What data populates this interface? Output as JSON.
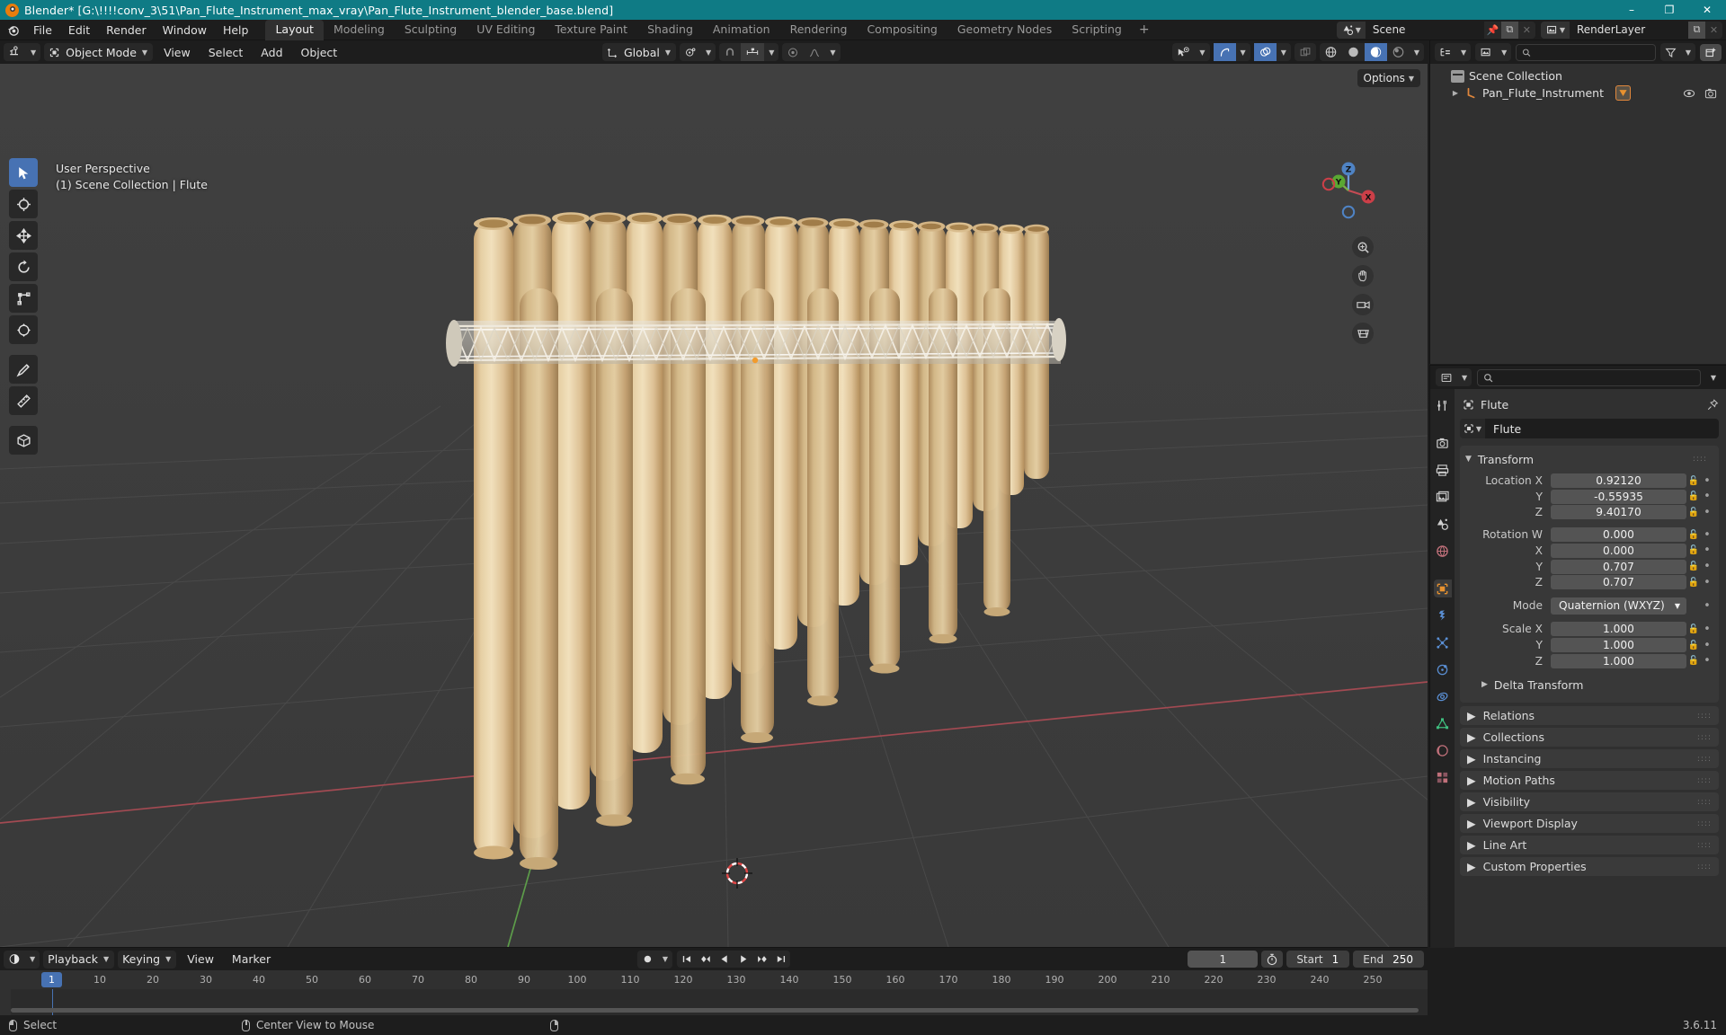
{
  "window": {
    "title": "Blender* [G:\\!!!!conv_3\\51\\Pan_Flute_Instrument_max_vray\\Pan_Flute_Instrument_blender_base.blend]",
    "minimize": "–",
    "maximize": "❐",
    "close": "✕"
  },
  "topbar": {
    "menus": [
      "File",
      "Edit",
      "Render",
      "Window",
      "Help"
    ],
    "workspaces": [
      "Layout",
      "Modeling",
      "Sculpting",
      "UV Editing",
      "Texture Paint",
      "Shading",
      "Animation",
      "Rendering",
      "Compositing",
      "Geometry Nodes",
      "Scripting"
    ],
    "active_workspace": "Layout",
    "add_workspace": "+",
    "scene_name": "Scene",
    "viewlayer_name": "RenderLayer",
    "new_copy": "⧉",
    "unlink": "✕"
  },
  "viewport": {
    "mode": "Object Mode",
    "menus": [
      "View",
      "Select",
      "Add",
      "Object"
    ],
    "transform_orientation": "Global",
    "options_label": "Options",
    "overlay_line1": "User Perspective",
    "overlay_line2": "(1) Scene Collection | Flute",
    "gizmo": {
      "x": "X",
      "y": "Y",
      "z": "Z"
    },
    "tools": [
      "tweak-select-tool",
      "cursor-tool",
      "move-tool",
      "rotate-tool",
      "scale-tool",
      "transform-tool",
      "annotate-tool",
      "measure-tool",
      "add-cube-tool"
    ]
  },
  "outliner": {
    "search_placeholder": "",
    "scene_collection": "Scene Collection",
    "items": [
      {
        "name": "Pan_Flute_Instrument",
        "type": "armature-object"
      }
    ]
  },
  "properties": {
    "breadcrumb_object": "Flute",
    "object_name": "Flute",
    "transform": {
      "title": "Transform",
      "rows": [
        {
          "label": "Location X",
          "value": "0.92120"
        },
        {
          "label": "Y",
          "value": "-0.55935"
        },
        {
          "label": "Z",
          "value": "9.40170"
        },
        {
          "label": "Rotation W",
          "value": "0.000"
        },
        {
          "label": "X",
          "value": "0.000"
        },
        {
          "label": "Y",
          "value": "0.707"
        },
        {
          "label": "Z",
          "value": "0.707"
        }
      ],
      "mode_label": "Mode",
      "mode_value": "Quaternion (WXYZ)",
      "scale_rows": [
        {
          "label": "Scale X",
          "value": "1.000"
        },
        {
          "label": "Y",
          "value": "1.000"
        },
        {
          "label": "Z",
          "value": "1.000"
        }
      ],
      "delta_transform": "Delta Transform"
    },
    "sections": [
      "Relations",
      "Collections",
      "Instancing",
      "Motion Paths",
      "Visibility",
      "Viewport Display",
      "Line Art",
      "Custom Properties"
    ],
    "tabs": [
      "tool-tab",
      "render-tab",
      "output-tab",
      "view-layer-tab",
      "scene-tab",
      "world-tab",
      "object-tab",
      "modifiers-tab",
      "particles-tab",
      "physics-tab",
      "constraints-tab",
      "data-tab",
      "material-tab",
      "texture-tab"
    ]
  },
  "timeline": {
    "menus": [
      "Playback",
      "Keying",
      "View",
      "Marker"
    ],
    "current_frame": "1",
    "start_label": "Start",
    "start_value": "1",
    "end_label": "End",
    "end_value": "250",
    "ticks": [
      "10",
      "20",
      "30",
      "40",
      "50",
      "60",
      "70",
      "80",
      "90",
      "100",
      "110",
      "120",
      "130",
      "140",
      "150",
      "160",
      "170",
      "180",
      "190",
      "200",
      "210",
      "220",
      "230",
      "240",
      "250"
    ],
    "playhead_label": "1"
  },
  "statusbar": {
    "items": [
      {
        "icon": "mouse-left-icon",
        "label": "Select"
      },
      {
        "icon": "mouse-middle-icon",
        "label": "Center View to Mouse"
      },
      {
        "icon": "mouse-right-icon",
        "label": ""
      }
    ],
    "version": "3.6.11"
  }
}
